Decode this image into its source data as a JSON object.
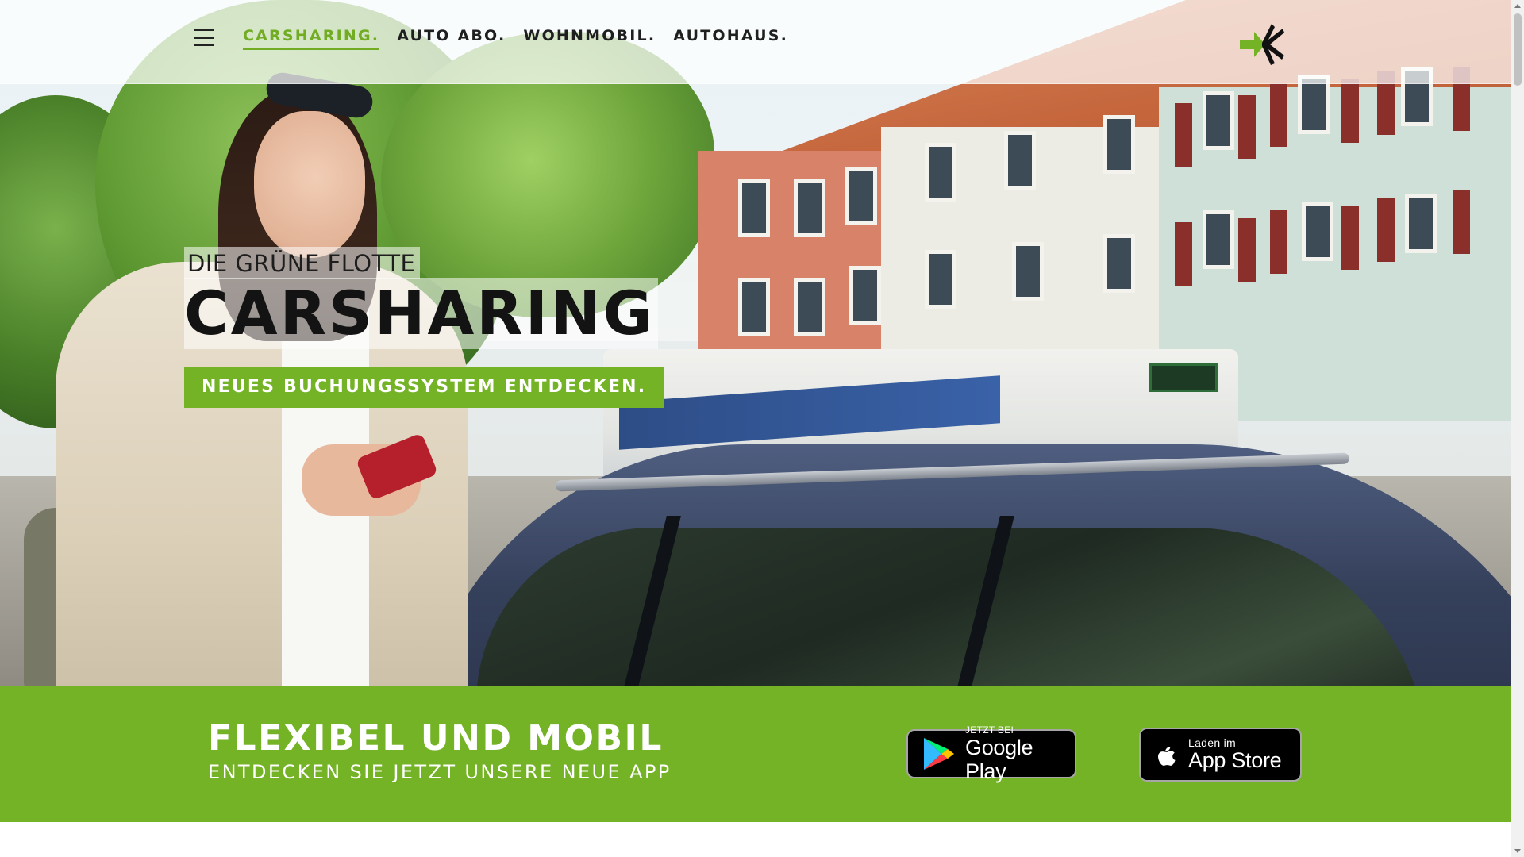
{
  "nav": {
    "menu_icon": "hamburger-menu-icon",
    "links": [
      {
        "label": "CARSHARING.",
        "active": true
      },
      {
        "label": "AUTO ABO.",
        "active": false
      },
      {
        "label": "WOHNMOBIL.",
        "active": false
      },
      {
        "label": "AUTOHAUS.",
        "active": false
      }
    ],
    "logo_icon": "arrow-logo-icon"
  },
  "hero": {
    "kicker": "DIE GRÜNE FLOTTE",
    "title": "CARSHARING",
    "cta_label": "NEUES BUCHUNGSSYSTEM ENTDECKEN."
  },
  "band": {
    "title": "FLEXIBEL UND MOBIL",
    "subtitle": "ENTDECKEN SIE JETZT UNSERE NEUE APP",
    "google_play": {
      "small": "JETZT BEI",
      "big": "Google Play",
      "icon": "google-play-icon"
    },
    "app_store": {
      "small": "Laden im",
      "big": "App Store",
      "icon": "apple-icon"
    }
  },
  "colors": {
    "brand_green": "#74b226",
    "nav_active": "#71ac23",
    "text_dark": "#1f1f1f"
  }
}
